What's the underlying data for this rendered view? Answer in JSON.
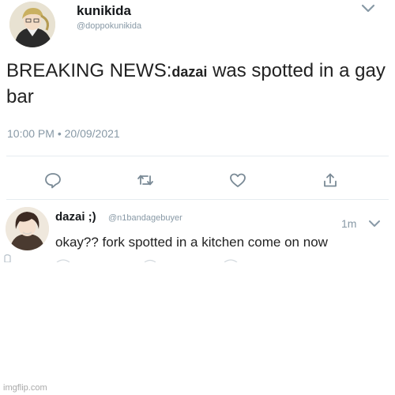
{
  "tweet": {
    "author_name": "kunikida",
    "author_handle": "@doppokunikida",
    "text_prefix": "BREAKING NEWS:",
    "text_bold": "dazai",
    "text_suffix": " was spotted in a gay bar",
    "timestamp": "10:00 PM • 20/09/2021",
    "actions": [
      "reply-icon",
      "retweet-icon",
      "like-icon",
      "share-icon"
    ]
  },
  "reply": {
    "author_name": "dazai ;)",
    "author_handle": "@n1bandagebuyer",
    "time": "1m",
    "text": "okay?? fork spotted in a kitchen come on now"
  },
  "watermark": "imgflip.com",
  "colors": {
    "text_primary": "#14171a",
    "text_secondary": "#8899a6",
    "divider": "#e6ecf0",
    "background": "#ffffff"
  }
}
